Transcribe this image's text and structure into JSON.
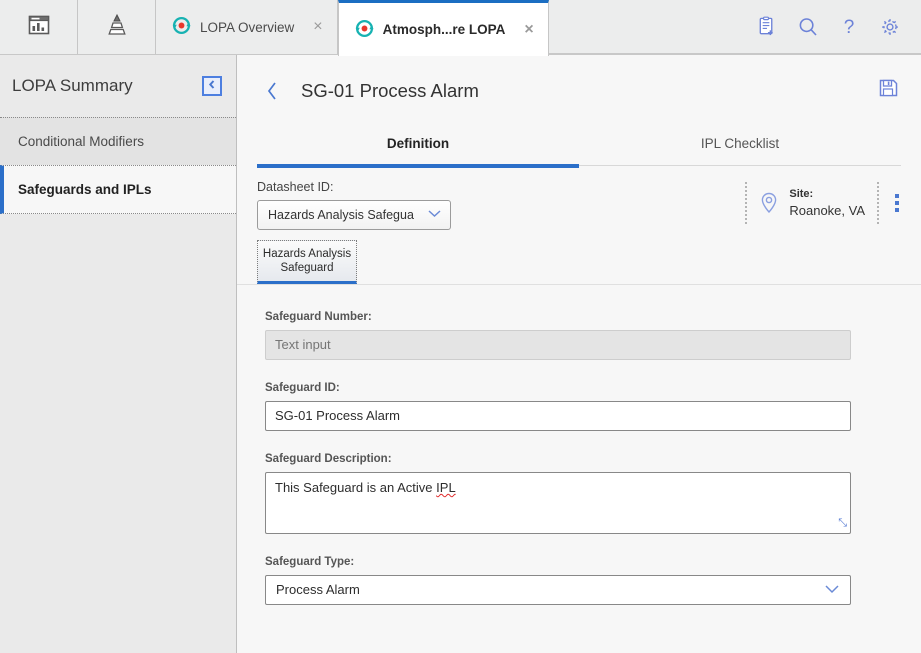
{
  "topbar": {
    "apps": [
      {
        "name": "dashboard-icon",
        "title": "Dashboard"
      },
      {
        "name": "hierarchy-icon",
        "title": "Hierarchy"
      }
    ],
    "tabs": [
      {
        "label": "LOPA Overview",
        "active": false,
        "icon": "lopa-record-icon",
        "close": "×"
      },
      {
        "label": "Atmosph...re LOPA",
        "active": true,
        "icon": "lopa-record-icon",
        "close": "×"
      }
    ],
    "actions": [
      {
        "name": "new-record-icon",
        "label": "New Record"
      },
      {
        "name": "search-icon",
        "label": "Search"
      },
      {
        "name": "help-icon",
        "label": "Help"
      },
      {
        "name": "gear-icon",
        "label": "Settings"
      }
    ]
  },
  "sidebar": {
    "title": "LOPA Summary",
    "collapse_glyph": "‹",
    "items": [
      {
        "label": "Conditional Modifiers",
        "selected": false
      },
      {
        "label": "Safeguards and IPLs",
        "selected": true
      }
    ]
  },
  "main": {
    "back_glyph": "‹",
    "title": "SG-01 Process Alarm",
    "save_label": "Save",
    "tabs": [
      {
        "label": "Definition",
        "active": true
      },
      {
        "label": "IPL Checklist",
        "active": false
      }
    ],
    "datasheet": {
      "label": "Datasheet ID:",
      "value": "Hazards Analysis Safegua",
      "chevron": "⌄"
    },
    "site": {
      "key": "Site:",
      "value": "Roanoke, VA"
    },
    "subtabs": [
      {
        "label": "Hazards Analysis Safeguard",
        "active": true
      }
    ],
    "fields": {
      "safeguard_number": {
        "label": "Safeguard Number:",
        "value": "",
        "placeholder": "Text input",
        "disabled": true
      },
      "safeguard_id": {
        "label": "Safeguard ID:",
        "value": "SG-01 Process Alarm",
        "placeholder": ""
      },
      "safeguard_description": {
        "label": "Safeguard Description:",
        "value_before": "This Safeguard is an Active ",
        "value_misspelled": "IPL",
        "resize_glyph": "⤡"
      },
      "safeguard_type": {
        "label": "Safeguard Type:",
        "value": "Process Alarm",
        "chevron": "⌄"
      }
    }
  },
  "colors": {
    "accent": "#2b6fc9",
    "icon_blue": "#4a78d0",
    "tab_icon_teal": "#17b2b2",
    "tab_icon_red": "#e8382d",
    "topbar_bg": "#eceded",
    "sidebar_bg": "#eaeaea",
    "main_bg": "#f7f7f7"
  }
}
